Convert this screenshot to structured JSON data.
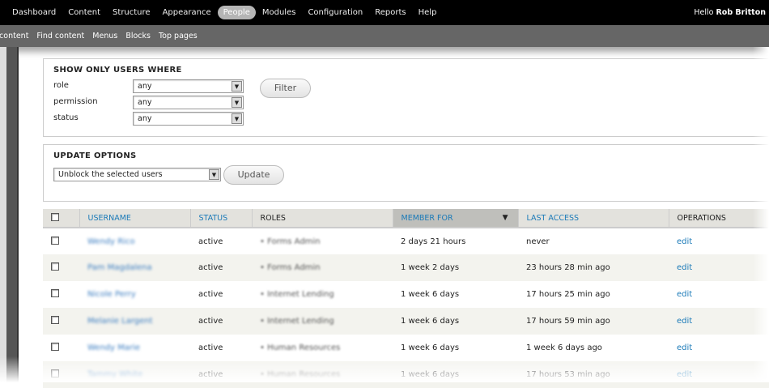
{
  "toolbar": {
    "items": [
      "Dashboard",
      "Content",
      "Structure",
      "Appearance",
      "People",
      "Modules",
      "Configuration",
      "Reports",
      "Help"
    ],
    "active": "People",
    "hello": "Hello",
    "user": "Rob Britton"
  },
  "shortcuts": [
    "d content",
    "Find content",
    "Menus",
    "Blocks",
    "Top pages"
  ],
  "filter": {
    "title": "SHOW ONLY USERS WHERE",
    "fields": [
      {
        "label": "role",
        "value": "any"
      },
      {
        "label": "permission",
        "value": "any"
      },
      {
        "label": "status",
        "value": "any"
      }
    ],
    "button": "Filter"
  },
  "update": {
    "title": "UPDATE OPTIONS",
    "action": "Unblock the selected users",
    "button": "Update"
  },
  "table": {
    "headers": [
      "USERNAME",
      "STATUS",
      "ROLES",
      "MEMBER FOR",
      "LAST ACCESS",
      "OPERATIONS"
    ],
    "rows": [
      {
        "username": "Wendy Rico",
        "status": "active",
        "role": "Forms Admin",
        "member_for": "2 days 21 hours",
        "last_access": "never",
        "op": "edit"
      },
      {
        "username": "Pam Magdalena",
        "status": "active",
        "role": "Forms Admin",
        "member_for": "1 week 2 days",
        "last_access": "23 hours 28 min ago",
        "op": "edit"
      },
      {
        "username": "Nicole Perry",
        "status": "active",
        "role": "Internet Lending",
        "member_for": "1 week 6 days",
        "last_access": "17 hours 25 min ago",
        "op": "edit"
      },
      {
        "username": "Melanie Largent",
        "status": "active",
        "role": "Internet Lending",
        "member_for": "1 week 6 days",
        "last_access": "17 hours 59 min ago",
        "op": "edit"
      },
      {
        "username": "Wendy Marie",
        "status": "active",
        "role": "Human Resources",
        "member_for": "1 week 6 days",
        "last_access": "1 week 6 days ago",
        "op": "edit"
      },
      {
        "username": "Tammy White",
        "status": "active",
        "role": "Human Resources",
        "member_for": "1 week 6 days",
        "last_access": "17 hours 53 min ago",
        "op": "edit"
      }
    ]
  }
}
